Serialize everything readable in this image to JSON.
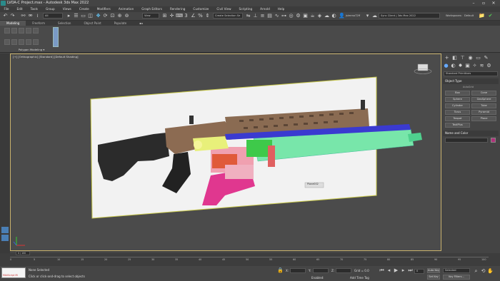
{
  "window": {
    "title": "LVOA-C Project.max - Autodesk 3ds Max 2022"
  },
  "menu": [
    "File",
    "Edit",
    "Tools",
    "Group",
    "Views",
    "Create",
    "Modifiers",
    "Animation",
    "Graph Editors",
    "Rendering",
    "Customize",
    "Civil View",
    "Scripting",
    "Arnold",
    "Help"
  ],
  "toolbar": {
    "selection_filter": "All",
    "view_dropdown": "View",
    "selection_set": "Create Selection Se",
    "user": "jsimmo72ff",
    "workspace_dropdown": "Sync Client | 3ds Max 2022",
    "workspaces_label": "Workspaces:",
    "workspaces_value": "Default"
  },
  "ribbon": {
    "tabs": [
      "Modeling",
      "Freeform",
      "Selection",
      "Object Paint",
      "Populate"
    ],
    "group_label": "Polygon Modeling"
  },
  "viewport": {
    "label": "[+] [Orthographic] [Standard] [Default Shading]",
    "object_label": "Plane002"
  },
  "command_panel": {
    "category": "Standard Primitives",
    "object_type_header": "Object Type",
    "autogrid": "AutoGrid",
    "buttons": [
      "Box",
      "Cone",
      "Sphere",
      "GeoSphere",
      "Cylinder",
      "Tube",
      "Torus",
      "Pyramid",
      "Teapot",
      "Plane",
      "TextPlus"
    ],
    "name_color_header": "Name and Color",
    "accent": "#b0307a"
  },
  "timeline": {
    "frame": "0 / 100",
    "ticks": [
      "0",
      "5",
      "10",
      "15",
      "20",
      "25",
      "30",
      "35",
      "40",
      "45",
      "50",
      "55",
      "60",
      "65",
      "70",
      "75",
      "80",
      "85",
      "90",
      "95",
      "100"
    ]
  },
  "status": {
    "maxscript": "MAXScript Mi",
    "selected": "None Selected",
    "prompt": "Click or click-and-drag to select objects",
    "x_label": "X:",
    "y_label": "Y:",
    "z_label": "Z:",
    "grid": "Grid = 0.0",
    "enabled": "Enabled:",
    "add_time_tag": "Add Time Tag",
    "autokey": "Auto Key",
    "setkey": "Set Key",
    "selected_dropdown": "Selected",
    "keyfilters": "Key Filters...",
    "frame_value": "0"
  }
}
